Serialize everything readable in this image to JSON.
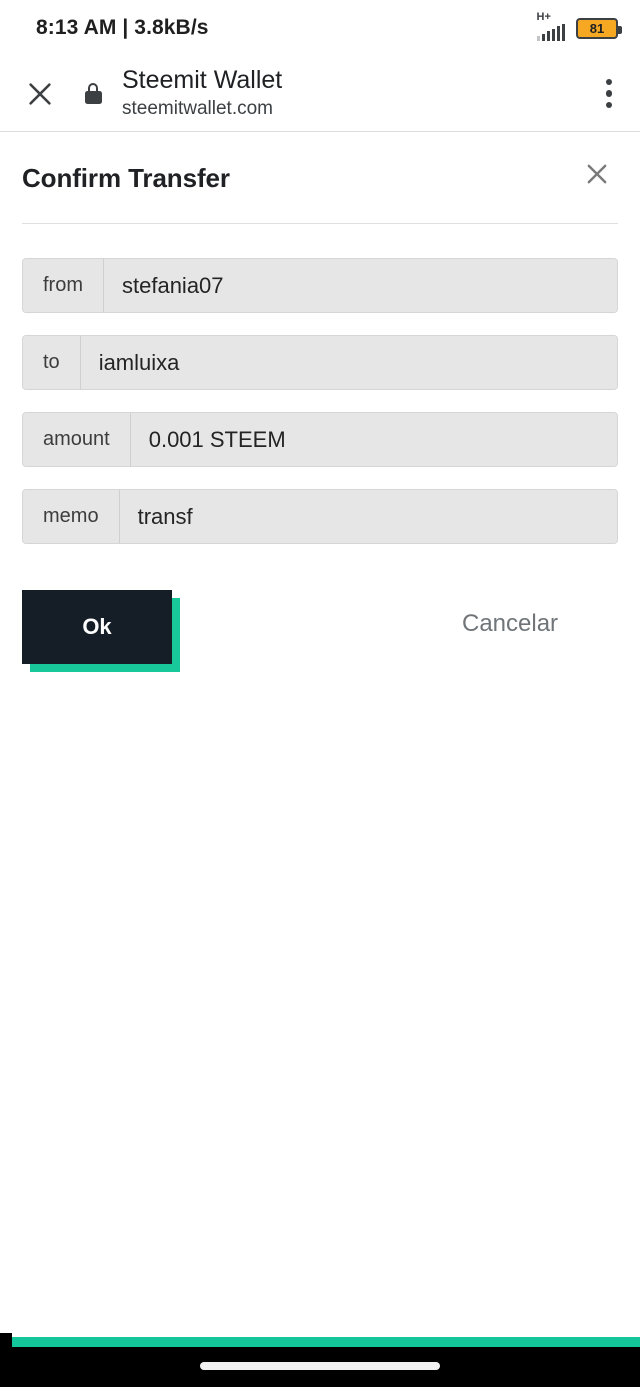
{
  "status_bar": {
    "time": "8:13 AM",
    "separator": "|",
    "network_speed": "3.8kB/s",
    "time_and_speed": "8:13 AM | 3.8kB/s",
    "network_type": "H+",
    "signal_icon": "signal-bars-icon",
    "battery_level": "81",
    "battery_color": "#f7a823"
  },
  "browser_toolbar": {
    "close_icon": "close-icon",
    "lock_icon": "lock-icon",
    "site_title": "Steemit Wallet",
    "site_url": "steemitwallet.com",
    "menu_icon": "overflow-menu-icon"
  },
  "dialog": {
    "title": "Confirm Transfer",
    "close_icon": "close-icon",
    "fields": [
      {
        "label": "from",
        "value": "stefania07"
      },
      {
        "label": "to",
        "value": "iamluixa"
      },
      {
        "label": "amount",
        "value": "0.001 STEEM"
      },
      {
        "label": "memo",
        "value": "transf"
      }
    ],
    "confirm_label": "Ok",
    "cancel_label": "Cancelar",
    "confirm_bg": "#151d26",
    "confirm_shadow": "#19c89a",
    "cancel_color": "#6f7579"
  },
  "bottom": {
    "accent_color": "#14c79b",
    "nav_background": "#000000",
    "home_indicator": "home-indicator-pill"
  }
}
